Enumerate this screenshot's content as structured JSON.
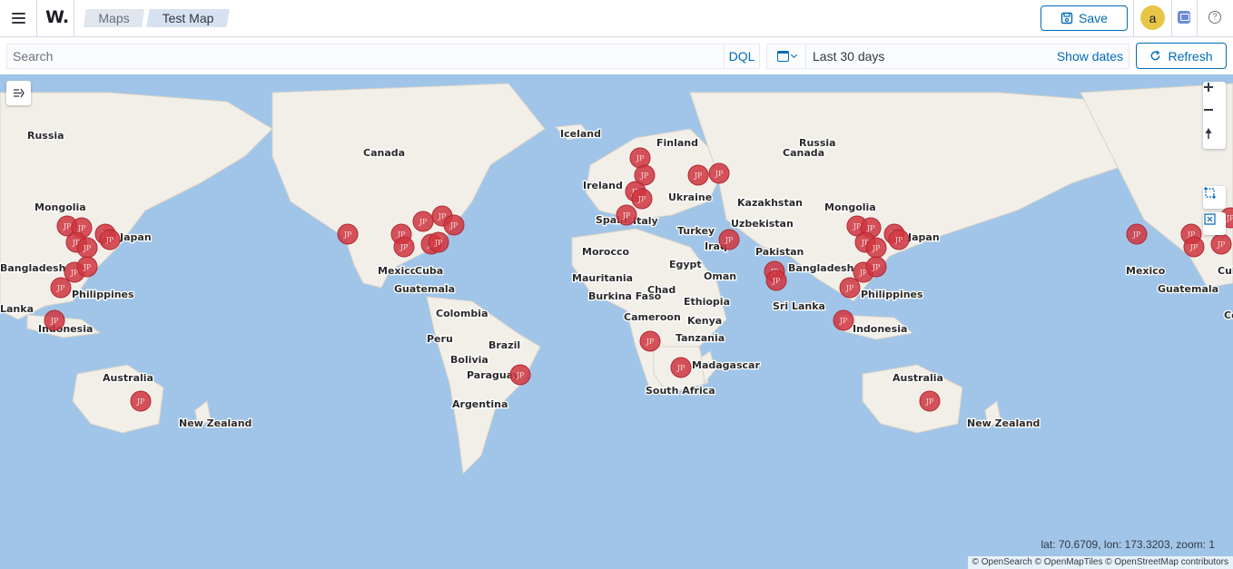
{
  "header": {
    "logo": "W.",
    "breadcrumbs": [
      "Maps",
      "Test Map"
    ],
    "save_label": "Save",
    "avatar_initial": "a",
    "help_glyph": "?"
  },
  "query": {
    "search_placeholder": "Search",
    "dql_label": "DQL",
    "date_range": "Last 30 days",
    "show_dates_label": "Show dates",
    "refresh_label": "Refresh"
  },
  "map": {
    "coords_readout": "lat: 70.6709, lon: 173.3203, zoom: 1",
    "attribution": "© OpenSearch © OpenMapTiles © OpenStreetMap contributors",
    "marker_glyph": "JP",
    "labels_world_a": [
      "Russia",
      "Canada",
      "Mongolia",
      "Japan",
      "Bangladesh",
      "Philippines",
      "Lanka",
      "Indonesia",
      "Australia",
      "New Zealand",
      "Mexico",
      "Cuba",
      "Guatemala",
      "Colombia",
      "Peru",
      "Brazil",
      "Bolivia",
      "Paraguay",
      "Argentina"
    ],
    "labels_world_b": [
      "Iceland",
      "Finland",
      "Russia",
      "Canada",
      "Ireland",
      "Ukraine",
      "Kazakhstan",
      "Spain",
      "Italy",
      "Uzbekistan",
      "Mongolia",
      "Turkey",
      "Iraq",
      "Japan",
      "Morocco",
      "Pakistan",
      "Egypt",
      "Oman",
      "Bangladesh",
      "Mexico",
      "Cub",
      "Mauritania",
      "Chad",
      "Burkina Faso",
      "Ethiopia",
      "Philippines",
      "Guatemala",
      "Sri Lanka",
      "Cameroon",
      "Kenya",
      "Co",
      "Tanzania",
      "Indonesia",
      "Madagascar",
      "South Africa",
      "Australia",
      "New Zealand"
    ]
  },
  "colors": {
    "accent": "#006bb8",
    "ocean": "#a0c5e8",
    "land": "#f2efe9",
    "marker": "#d0353f"
  },
  "icons": [
    "menu-icon",
    "save-icon",
    "notification-icon",
    "help-icon",
    "calendar-icon",
    "chevron-down-icon",
    "refresh-icon",
    "layers-icon",
    "zoom-in-icon",
    "zoom-out-icon",
    "compass-icon",
    "draw-shape-icon",
    "draw-bounds-icon"
  ]
}
